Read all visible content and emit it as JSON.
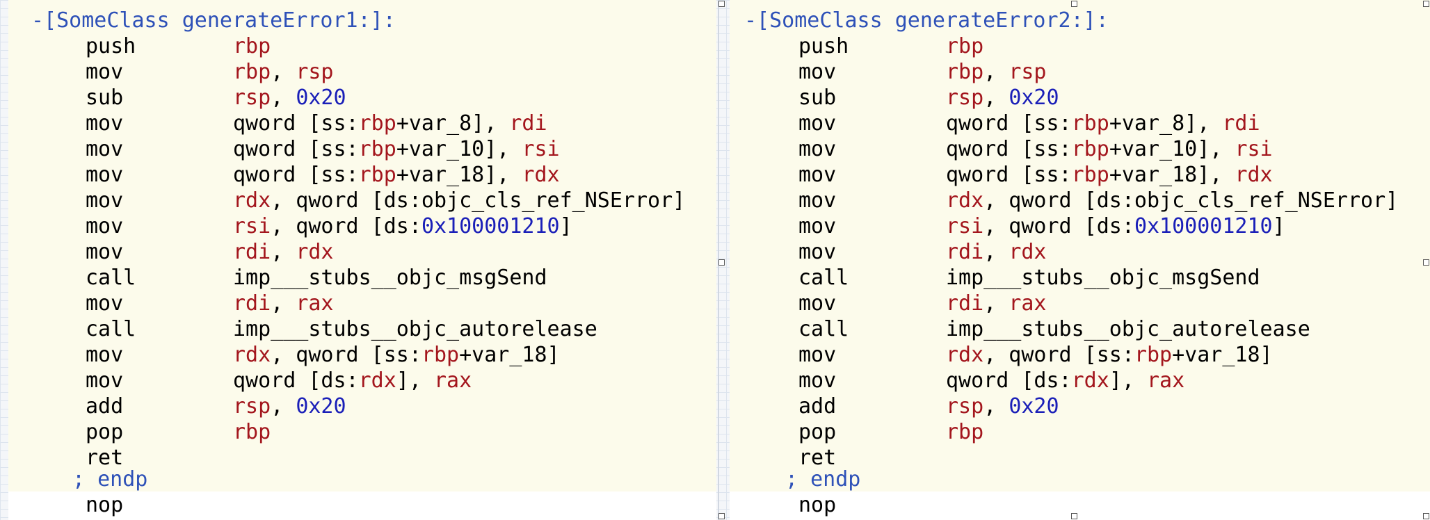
{
  "panels": [
    {
      "header": "-[SomeClass generateError1:]:",
      "lines": [
        {
          "mnemonic": "push",
          "operands": [
            {
              "t": "rbp",
              "c": "r"
            }
          ]
        },
        {
          "mnemonic": "mov",
          "operands": [
            {
              "t": "rbp",
              "c": "r"
            },
            {
              "t": ", ",
              "c": "k"
            },
            {
              "t": "rsp",
              "c": "r"
            }
          ]
        },
        {
          "mnemonic": "sub",
          "operands": [
            {
              "t": "rsp",
              "c": "r"
            },
            {
              "t": ", ",
              "c": "k"
            },
            {
              "t": "0x20",
              "c": "n"
            }
          ]
        },
        {
          "mnemonic": "mov",
          "operands": [
            {
              "t": "qword [ss:",
              "c": "k"
            },
            {
              "t": "rbp",
              "c": "r"
            },
            {
              "t": "+var_8], ",
              "c": "k"
            },
            {
              "t": "rdi",
              "c": "r"
            }
          ]
        },
        {
          "mnemonic": "mov",
          "operands": [
            {
              "t": "qword [ss:",
              "c": "k"
            },
            {
              "t": "rbp",
              "c": "r"
            },
            {
              "t": "+var_10], ",
              "c": "k"
            },
            {
              "t": "rsi",
              "c": "r"
            }
          ]
        },
        {
          "mnemonic": "mov",
          "operands": [
            {
              "t": "qword [ss:",
              "c": "k"
            },
            {
              "t": "rbp",
              "c": "r"
            },
            {
              "t": "+var_18], ",
              "c": "k"
            },
            {
              "t": "rdx",
              "c": "r"
            }
          ]
        },
        {
          "mnemonic": "mov",
          "operands": [
            {
              "t": "rdx",
              "c": "r"
            },
            {
              "t": ", qword [ds:objc_cls_ref_NSError]",
              "c": "k"
            }
          ]
        },
        {
          "mnemonic": "mov",
          "operands": [
            {
              "t": "rsi",
              "c": "r"
            },
            {
              "t": ", qword [ds:",
              "c": "k"
            },
            {
              "t": "0x100001210",
              "c": "n"
            },
            {
              "t": "]",
              "c": "k"
            }
          ]
        },
        {
          "mnemonic": "mov",
          "operands": [
            {
              "t": "rdi",
              "c": "r"
            },
            {
              "t": ", ",
              "c": "k"
            },
            {
              "t": "rdx",
              "c": "r"
            }
          ]
        },
        {
          "mnemonic": "call",
          "operands": [
            {
              "t": "imp___stubs__objc_msgSend",
              "c": "k"
            }
          ]
        },
        {
          "mnemonic": "mov",
          "operands": [
            {
              "t": "rdi",
              "c": "r"
            },
            {
              "t": ", ",
              "c": "k"
            },
            {
              "t": "rax",
              "c": "r"
            }
          ]
        },
        {
          "mnemonic": "call",
          "operands": [
            {
              "t": "imp___stubs__objc_autorelease",
              "c": "k"
            }
          ]
        },
        {
          "mnemonic": "mov",
          "operands": [
            {
              "t": "rdx",
              "c": "r"
            },
            {
              "t": ", qword [ss:",
              "c": "k"
            },
            {
              "t": "rbp",
              "c": "r"
            },
            {
              "t": "+var_18]",
              "c": "k"
            }
          ]
        },
        {
          "mnemonic": "mov",
          "operands": [
            {
              "t": "qword [ds:",
              "c": "k"
            },
            {
              "t": "rdx",
              "c": "r"
            },
            {
              "t": "], ",
              "c": "k"
            },
            {
              "t": "rax",
              "c": "r"
            }
          ]
        },
        {
          "mnemonic": "add",
          "operands": [
            {
              "t": "rsp",
              "c": "r"
            },
            {
              "t": ", ",
              "c": "k"
            },
            {
              "t": "0x20",
              "c": "n"
            }
          ]
        },
        {
          "mnemonic": "pop",
          "operands": [
            {
              "t": "rbp",
              "c": "r"
            }
          ]
        },
        {
          "mnemonic": "ret",
          "operands": []
        }
      ],
      "endp": "; endp",
      "nop": "nop"
    },
    {
      "header": "-[SomeClass generateError2:]:",
      "lines": [
        {
          "mnemonic": "push",
          "operands": [
            {
              "t": "rbp",
              "c": "r"
            }
          ]
        },
        {
          "mnemonic": "mov",
          "operands": [
            {
              "t": "rbp",
              "c": "r"
            },
            {
              "t": ", ",
              "c": "k"
            },
            {
              "t": "rsp",
              "c": "r"
            }
          ]
        },
        {
          "mnemonic": "sub",
          "operands": [
            {
              "t": "rsp",
              "c": "r"
            },
            {
              "t": ", ",
              "c": "k"
            },
            {
              "t": "0x20",
              "c": "n"
            }
          ]
        },
        {
          "mnemonic": "mov",
          "operands": [
            {
              "t": "qword [ss:",
              "c": "k"
            },
            {
              "t": "rbp",
              "c": "r"
            },
            {
              "t": "+var_8], ",
              "c": "k"
            },
            {
              "t": "rdi",
              "c": "r"
            }
          ]
        },
        {
          "mnemonic": "mov",
          "operands": [
            {
              "t": "qword [ss:",
              "c": "k"
            },
            {
              "t": "rbp",
              "c": "r"
            },
            {
              "t": "+var_10], ",
              "c": "k"
            },
            {
              "t": "rsi",
              "c": "r"
            }
          ]
        },
        {
          "mnemonic": "mov",
          "operands": [
            {
              "t": "qword [ss:",
              "c": "k"
            },
            {
              "t": "rbp",
              "c": "r"
            },
            {
              "t": "+var_18], ",
              "c": "k"
            },
            {
              "t": "rdx",
              "c": "r"
            }
          ]
        },
        {
          "mnemonic": "mov",
          "operands": [
            {
              "t": "rdx",
              "c": "r"
            },
            {
              "t": ", qword [ds:objc_cls_ref_NSError]",
              "c": "k"
            }
          ]
        },
        {
          "mnemonic": "mov",
          "operands": [
            {
              "t": "rsi",
              "c": "r"
            },
            {
              "t": ", qword [ds:",
              "c": "k"
            },
            {
              "t": "0x100001210",
              "c": "n"
            },
            {
              "t": "]",
              "c": "k"
            }
          ]
        },
        {
          "mnemonic": "mov",
          "operands": [
            {
              "t": "rdi",
              "c": "r"
            },
            {
              "t": ", ",
              "c": "k"
            },
            {
              "t": "rdx",
              "c": "r"
            }
          ]
        },
        {
          "mnemonic": "call",
          "operands": [
            {
              "t": "imp___stubs__objc_msgSend",
              "c": "k"
            }
          ]
        },
        {
          "mnemonic": "mov",
          "operands": [
            {
              "t": "rdi",
              "c": "r"
            },
            {
              "t": ", ",
              "c": "k"
            },
            {
              "t": "rax",
              "c": "r"
            }
          ]
        },
        {
          "mnemonic": "call",
          "operands": [
            {
              "t": "imp___stubs__objc_autorelease",
              "c": "k"
            }
          ]
        },
        {
          "mnemonic": "mov",
          "operands": [
            {
              "t": "rdx",
              "c": "r"
            },
            {
              "t": ", qword [ss:",
              "c": "k"
            },
            {
              "t": "rbp",
              "c": "r"
            },
            {
              "t": "+var_18]",
              "c": "k"
            }
          ]
        },
        {
          "mnemonic": "mov",
          "operands": [
            {
              "t": "qword [ds:",
              "c": "k"
            },
            {
              "t": "rdx",
              "c": "r"
            },
            {
              "t": "], ",
              "c": "k"
            },
            {
              "t": "rax",
              "c": "r"
            }
          ]
        },
        {
          "mnemonic": "add",
          "operands": [
            {
              "t": "rsp",
              "c": "r"
            },
            {
              "t": ", ",
              "c": "k"
            },
            {
              "t": "0x20",
              "c": "n"
            }
          ]
        },
        {
          "mnemonic": "pop",
          "operands": [
            {
              "t": "rbp",
              "c": "r"
            }
          ]
        },
        {
          "mnemonic": "ret",
          "operands": []
        }
      ],
      "endp": "; endp",
      "nop": "nop"
    }
  ],
  "colors": {
    "register": "#a3161d",
    "number": "#1a1fb8",
    "label": "#2e51b8",
    "code_background": "#fcfbeb"
  }
}
